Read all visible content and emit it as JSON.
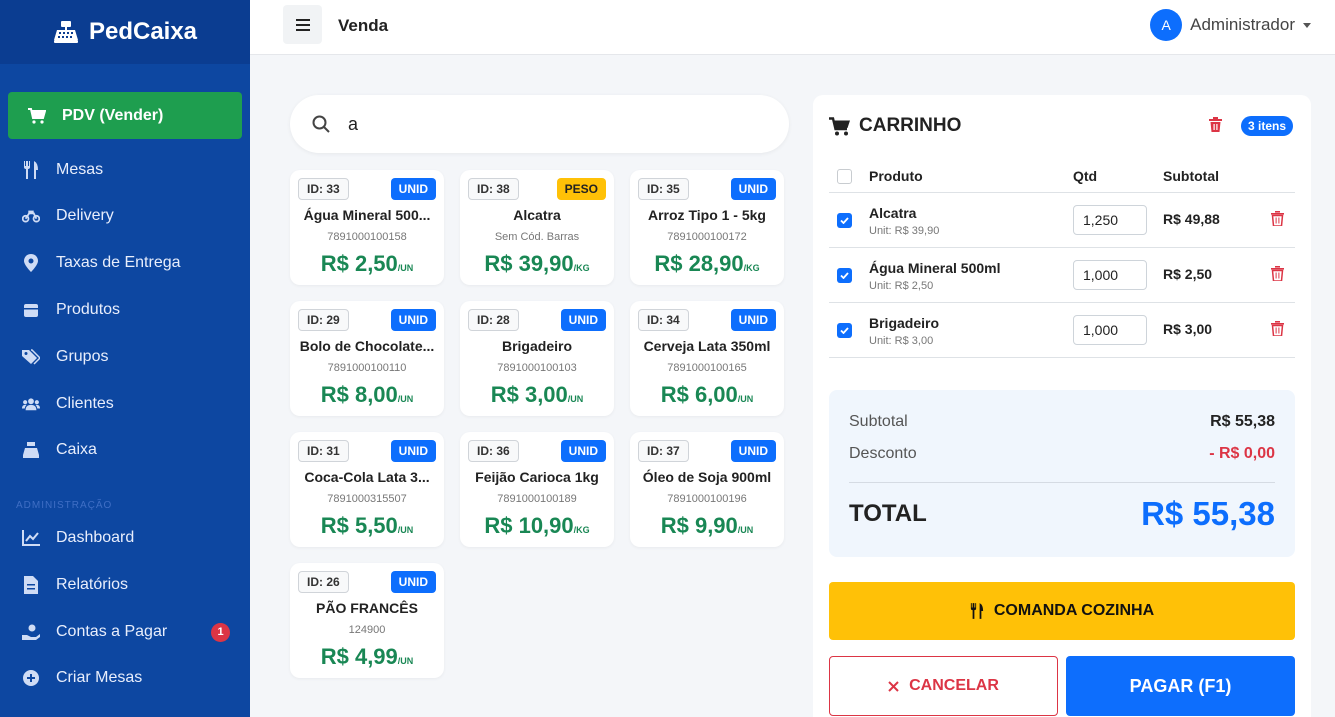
{
  "sidebar": {
    "brand": "PedCaixa",
    "active": "PDV (Vender)",
    "items": [
      "Mesas",
      "Delivery",
      "Taxas de Entrega",
      "Produtos",
      "Grupos",
      "Clientes",
      "Caixa"
    ],
    "section": "ADMINISTRAÇÃO",
    "admin_items": [
      "Dashboard",
      "Relatórios",
      "Contas a Pagar",
      "Criar Mesas"
    ],
    "contas_badge": "1"
  },
  "header": {
    "title": "Venda",
    "user": "Administrador",
    "avatar": "A"
  },
  "search": {
    "value": "a"
  },
  "products": [
    {
      "id": "ID: 33",
      "type": "UNID",
      "name": "Água Mineral 500...",
      "code": "7891000100158",
      "price": "R$ 2,50",
      "unit": "/UN"
    },
    {
      "id": "ID: 38",
      "type": "PESO",
      "name": "Alcatra",
      "code": "Sem Cód. Barras",
      "price": "R$ 39,90",
      "unit": "/KG"
    },
    {
      "id": "ID: 35",
      "type": "UNID",
      "name": "Arroz Tipo 1 - 5kg",
      "code": "7891000100172",
      "price": "R$ 28,90",
      "unit": "/KG"
    },
    {
      "id": "ID: 29",
      "type": "UNID",
      "name": "Bolo de Chocolate...",
      "code": "7891000100110",
      "price": "R$ 8,00",
      "unit": "/UN"
    },
    {
      "id": "ID: 28",
      "type": "UNID",
      "name": "Brigadeiro",
      "code": "7891000100103",
      "price": "R$ 3,00",
      "unit": "/UN"
    },
    {
      "id": "ID: 34",
      "type": "UNID",
      "name": "Cerveja Lata 350ml",
      "code": "7891000100165",
      "price": "R$ 6,00",
      "unit": "/UN"
    },
    {
      "id": "ID: 31",
      "type": "UNID",
      "name": "Coca-Cola Lata 3...",
      "code": "7891000315507",
      "price": "R$ 5,50",
      "unit": "/UN"
    },
    {
      "id": "ID: 36",
      "type": "UNID",
      "name": "Feijão Carioca 1kg",
      "code": "7891000100189",
      "price": "R$ 10,90",
      "unit": "/KG"
    },
    {
      "id": "ID: 37",
      "type": "UNID",
      "name": "Óleo de Soja 900ml",
      "code": "7891000100196",
      "price": "R$ 9,90",
      "unit": "/UN"
    },
    {
      "id": "ID: 26",
      "type": "UNID",
      "name": "PÃO FRANCÊS",
      "code": "124900",
      "price": "R$ 4,99",
      "unit": "/UN"
    }
  ],
  "cart": {
    "title": "CARRINHO",
    "count": "3 itens",
    "headers": {
      "product": "Produto",
      "qty": "Qtd",
      "subtotal": "Subtotal"
    },
    "items": [
      {
        "name": "Alcatra",
        "unit": "Unit: R$ 39,90",
        "qty": "1,250",
        "subtotal": "R$ 49,88"
      },
      {
        "name": "Água Mineral 500ml",
        "unit": "Unit: R$ 2,50",
        "qty": "1,000",
        "subtotal": "R$ 2,50"
      },
      {
        "name": "Brigadeiro",
        "unit": "Unit: R$ 3,00",
        "qty": "1,000",
        "subtotal": "R$ 3,00"
      }
    ],
    "subtotal_label": "Subtotal",
    "subtotal": "R$ 55,38",
    "discount_label": "Desconto",
    "discount": "- R$ 0,00",
    "total_label": "TOTAL",
    "total": "R$ 55,38",
    "kitchen_btn": "COMANDA COZINHA",
    "cancel_btn": "CANCELAR",
    "pay_btn": "PAGAR (F1)"
  }
}
